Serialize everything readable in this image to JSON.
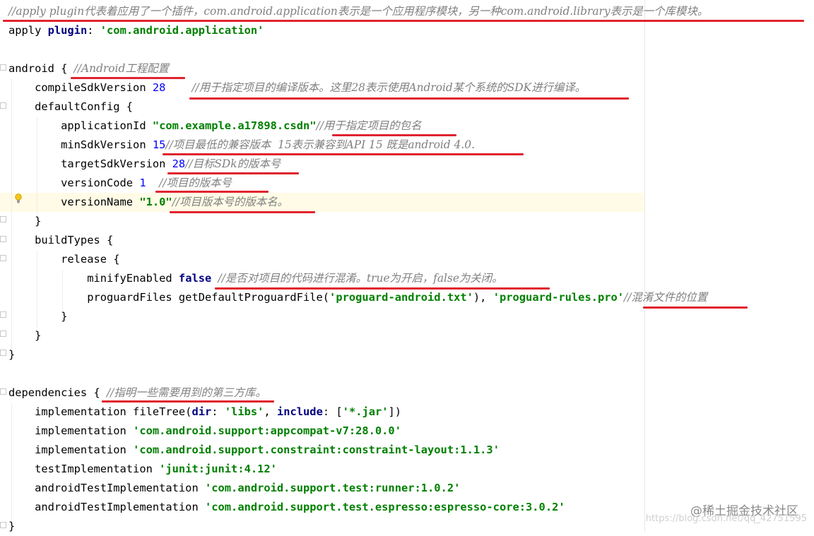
{
  "editor": {
    "lines": [
      {
        "parts": [
          {
            "t": "//apply plugin代表着应用了一个插件，com.android.application表示是一个应用程序模块，另一种com.android.library表示是一个库模块。",
            "c": "cmt"
          }
        ]
      },
      {
        "parts": [
          {
            "t": "apply ",
            "c": "plain"
          },
          {
            "t": "plugin",
            "c": "kw"
          },
          {
            "t": ": ",
            "c": "plain"
          },
          {
            "t": "'com.android.application'",
            "c": "str"
          }
        ]
      },
      {
        "parts": []
      },
      {
        "parts": [
          {
            "t": "android { ",
            "c": "plain"
          },
          {
            "t": "//Android工程配置",
            "c": "cmt"
          }
        ]
      },
      {
        "parts": [
          {
            "t": "    compileSdkVersion ",
            "c": "plain"
          },
          {
            "t": "28",
            "c": "num"
          },
          {
            "t": "    ",
            "c": "plain"
          },
          {
            "t": "//用于指定项目的编译版本。这里28表示使用Android某个系统的SDK进行编译。",
            "c": "cmt"
          }
        ]
      },
      {
        "parts": [
          {
            "t": "    defaultConfig {",
            "c": "plain"
          }
        ]
      },
      {
        "parts": [
          {
            "t": "        applicationId ",
            "c": "plain"
          },
          {
            "t": "\"com.example.a17898.csdn\"",
            "c": "str"
          },
          {
            "t": "//用于指定项目的包名",
            "c": "cmt"
          }
        ]
      },
      {
        "parts": [
          {
            "t": "        minSdkVersion ",
            "c": "plain"
          },
          {
            "t": "15",
            "c": "num"
          },
          {
            "t": "//项目最低的兼容版本  15表示兼容到API 15 既是android 4.0.",
            "c": "cmt"
          }
        ]
      },
      {
        "parts": [
          {
            "t": "        targetSdkVersion ",
            "c": "plain"
          },
          {
            "t": "28",
            "c": "num"
          },
          {
            "t": "//目标SDk的版本号",
            "c": "cmt"
          }
        ]
      },
      {
        "parts": [
          {
            "t": "        versionCode ",
            "c": "plain"
          },
          {
            "t": "1",
            "c": "num"
          },
          {
            "t": "  ",
            "c": "plain"
          },
          {
            "t": "//项目的版本号",
            "c": "cmt"
          }
        ]
      },
      {
        "parts": [
          {
            "t": "        versionName ",
            "c": "plain"
          },
          {
            "t": "\"1.0\"",
            "c": "str"
          },
          {
            "t": "//项目版本号的版本名。",
            "c": "cmt"
          }
        ]
      },
      {
        "parts": [
          {
            "t": "    }",
            "c": "plain"
          }
        ]
      },
      {
        "parts": [
          {
            "t": "    buildTypes {",
            "c": "plain"
          }
        ]
      },
      {
        "parts": [
          {
            "t": "        release {",
            "c": "plain"
          }
        ]
      },
      {
        "parts": [
          {
            "t": "            minifyEnabled ",
            "c": "plain"
          },
          {
            "t": "false",
            "c": "kw"
          },
          {
            "t": " ",
            "c": "plain"
          },
          {
            "t": "//是否对项目的代码进行混淆。true为开启，false为关闭。",
            "c": "cmt"
          }
        ]
      },
      {
        "parts": [
          {
            "t": "            proguardFiles getDefaultProguardFile(",
            "c": "plain"
          },
          {
            "t": "'proguard-android.txt'",
            "c": "str"
          },
          {
            "t": "), ",
            "c": "plain"
          },
          {
            "t": "'proguard-rules.pro'",
            "c": "str"
          },
          {
            "t": "//混淆文件的位置",
            "c": "cmt"
          }
        ]
      },
      {
        "parts": [
          {
            "t": "        }",
            "c": "plain"
          }
        ]
      },
      {
        "parts": [
          {
            "t": "    }",
            "c": "plain"
          }
        ]
      },
      {
        "parts": [
          {
            "t": "}",
            "c": "plain"
          }
        ]
      },
      {
        "parts": []
      },
      {
        "parts": [
          {
            "t": "dependencies { ",
            "c": "plain"
          },
          {
            "t": "//指明一些需要用到的第三方库。",
            "c": "cmt"
          }
        ]
      },
      {
        "parts": [
          {
            "t": "    implementation fileTree(",
            "c": "plain"
          },
          {
            "t": "dir",
            "c": "kw"
          },
          {
            "t": ": ",
            "c": "plain"
          },
          {
            "t": "'libs'",
            "c": "str"
          },
          {
            "t": ", ",
            "c": "plain"
          },
          {
            "t": "include",
            "c": "kw"
          },
          {
            "t": ": [",
            "c": "plain"
          },
          {
            "t": "'*.jar'",
            "c": "str"
          },
          {
            "t": "])",
            "c": "plain"
          }
        ]
      },
      {
        "parts": [
          {
            "t": "    implementation ",
            "c": "plain"
          },
          {
            "t": "'com.android.support:appcompat-v7:28.0.0'",
            "c": "str"
          }
        ]
      },
      {
        "parts": [
          {
            "t": "    implementation ",
            "c": "plain"
          },
          {
            "t": "'com.android.support.constraint:constraint-layout:1.1.3'",
            "c": "str"
          }
        ]
      },
      {
        "parts": [
          {
            "t": "    testImplementation ",
            "c": "plain"
          },
          {
            "t": "'junit:junit:4.12'",
            "c": "str"
          }
        ]
      },
      {
        "parts": [
          {
            "t": "    androidTestImplementation ",
            "c": "plain"
          },
          {
            "t": "'com.android.support.test:runner:1.0.2'",
            "c": "str"
          }
        ]
      },
      {
        "parts": [
          {
            "t": "    androidTestImplementation ",
            "c": "plain"
          },
          {
            "t": "'com.android.support.test.espresso:espresso-core:3.0.2'",
            "c": "str"
          }
        ]
      },
      {
        "parts": [
          {
            "t": "}",
            "c": "plain"
          }
        ]
      }
    ],
    "colors": {
      "keyword": "#000080",
      "string": "#008000",
      "number": "#0000ff",
      "comment": "#808080",
      "underline": "#e0242e",
      "current_line": "#fffbe6"
    }
  },
  "watermark": {
    "brand": "@稀土掘金技术社区",
    "url": "https://blog.csdn.net/qq_42751595"
  }
}
